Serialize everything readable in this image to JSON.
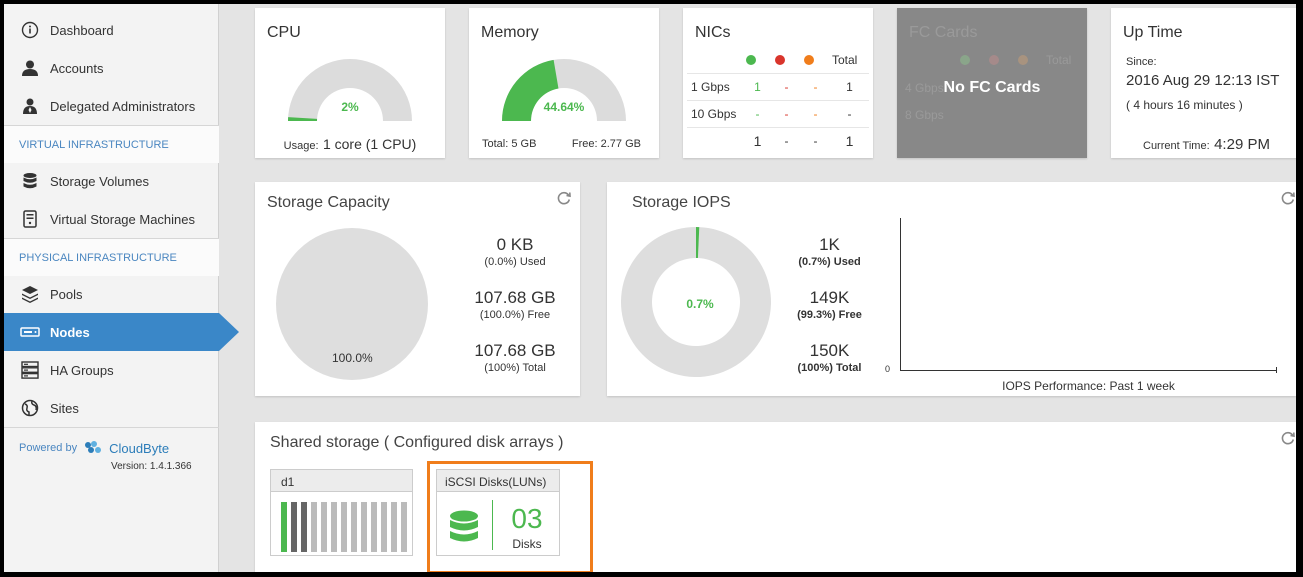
{
  "sidebar": {
    "items_top": [
      {
        "label": "Dashboard",
        "icon": "info-icon"
      },
      {
        "label": "Accounts",
        "icon": "user-icon"
      },
      {
        "label": "Delegated Administrators",
        "icon": "admin-icon"
      }
    ],
    "section_virtual": "VIRTUAL INFRASTRUCTURE",
    "items_virtual": [
      {
        "label": "Storage Volumes",
        "icon": "database-icon"
      },
      {
        "label": "Virtual Storage Machines",
        "icon": "server-icon"
      }
    ],
    "section_physical": "PHYSICAL INFRASTRUCTURE",
    "items_physical": [
      {
        "label": "Pools",
        "icon": "layers-icon"
      },
      {
        "label": "Nodes",
        "icon": "node-icon",
        "active": true
      },
      {
        "label": "HA Groups",
        "icon": "ha-icon"
      },
      {
        "label": "Sites",
        "icon": "globe-icon"
      }
    ],
    "powered_by": "Powered by",
    "brand": "CloudByte",
    "version": "Version: 1.4.1.366"
  },
  "cpu": {
    "title": "CPU",
    "percent_label": "2%",
    "percent": 2,
    "usage_prefix": "Usage:",
    "usage_value": "1 core (1 CPU)"
  },
  "memory": {
    "title": "Memory",
    "percent_label": "44.64%",
    "percent": 44.64,
    "total": "Total: 5 GB",
    "free": "Free: 2.77 GB"
  },
  "nics": {
    "title": "NICs",
    "total_header": "Total",
    "rows": [
      {
        "label": "1 Gbps",
        "green": "1",
        "red": "-",
        "orange": "-",
        "total": "1"
      },
      {
        "label": "10 Gbps",
        "green": "-",
        "red": "-",
        "orange": "-",
        "total": "-"
      },
      {
        "label": "",
        "green": "1",
        "red": "-",
        "orange": "-",
        "total": "1"
      }
    ]
  },
  "fc_cards": {
    "title": "FC Cards",
    "total_header": "Total",
    "overlay": "No FC Cards",
    "row1": "4 Gbps",
    "row2": "8 Gbps"
  },
  "uptime": {
    "title": "Up Time",
    "since_label": "Since:",
    "since_value": "2016 Aug 29 12:13 IST",
    "duration": "( 4 hours 16 minutes )",
    "current_label": "Current Time:",
    "current_value": "4:29 PM"
  },
  "storage_capacity": {
    "title": "Storage Capacity",
    "pie_label": "100.0%",
    "used_value": "0 KB",
    "used_label": "(0.0%) Used",
    "free_value": "107.68 GB",
    "free_label": "(100.0%) Free",
    "total_value": "107.68 GB",
    "total_label": "(100%) Total"
  },
  "storage_iops": {
    "title": "Storage IOPS",
    "donut_label": "0.7%",
    "used_fraction": 0.007,
    "used_value": "1K",
    "used_label": "(0.7%) Used",
    "free_value": "149K",
    "free_label": "(99.3%) Free",
    "total_value": "150K",
    "total_label": "(100%) Total",
    "axis_zero": "0",
    "chart_caption": "IOPS Performance: Past 1 week"
  },
  "shared_storage": {
    "title": "Shared storage ( Configured disk arrays )",
    "array_name": "d1",
    "iscsi_title": "iSCSI Disks(LUNs)",
    "disk_count": "03",
    "disk_label": "Disks"
  },
  "colors": {
    "accent": "#3a87c8",
    "green": "#4cb84f",
    "red": "#d9352c",
    "orange": "#f07d1b",
    "highlight": "#f07d1b"
  }
}
